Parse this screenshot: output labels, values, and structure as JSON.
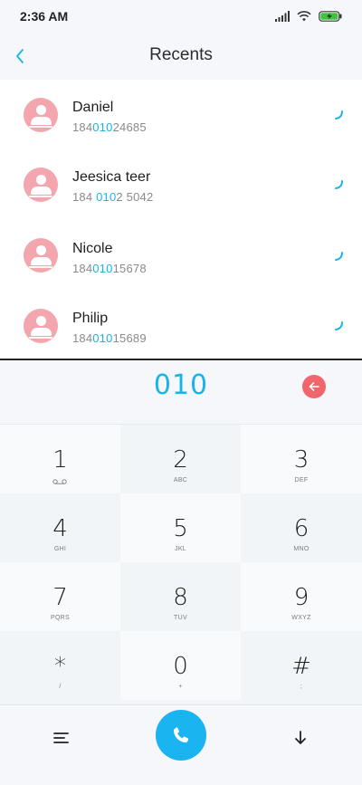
{
  "status_bar": {
    "time": "2:36 AM",
    "icons": [
      "signal-icon",
      "wifi-icon",
      "battery-charging-icon"
    ]
  },
  "header": {
    "title": "Recents",
    "back_icon": "chevron-left-icon"
  },
  "contacts": [
    {
      "name": "Daniel",
      "number_parts": [
        "184",
        "010",
        "24685"
      ],
      "call_icon": "call-outgoing-icon"
    },
    {
      "name": "Jeesica teer",
      "number_parts": [
        "184 ",
        "010",
        "2 5042"
      ],
      "call_icon": "call-outgoing-icon"
    },
    {
      "name": "Nicole",
      "number_parts": [
        "184",
        "010",
        "15678"
      ],
      "call_icon": "call-outgoing-icon"
    },
    {
      "name": "Philip",
      "number_parts": [
        "184",
        "010",
        "15689"
      ],
      "call_icon": "call-outgoing-icon"
    }
  ],
  "dial_input": {
    "value": "010",
    "delete_icon": "backspace-arrow-icon"
  },
  "keypad": {
    "keys": [
      {
        "digit": "1",
        "letters": ""
      },
      {
        "digit": "2",
        "letters": "ABC"
      },
      {
        "digit": "3",
        "letters": "DEF"
      },
      {
        "digit": "4",
        "letters": "GHI"
      },
      {
        "digit": "5",
        "letters": "JKL"
      },
      {
        "digit": "6",
        "letters": "MNO"
      },
      {
        "digit": "7",
        "letters": "PQRS"
      },
      {
        "digit": "8",
        "letters": "TUV"
      },
      {
        "digit": "9",
        "letters": "WXYZ"
      },
      {
        "digit": "*",
        "letters": "/"
      },
      {
        "digit": "0",
        "letters": "+"
      },
      {
        "digit": "#",
        "letters": ";"
      }
    ]
  },
  "bottom_bar": {
    "menu_icon": "menu-icon",
    "call_icon": "phone-icon",
    "collapse_icon": "arrow-down-icon"
  },
  "colors": {
    "accent": "#1ab4e6",
    "avatar": "#f3a6ad",
    "delete": "#f0666c",
    "call_button": "#1ab4f0"
  }
}
